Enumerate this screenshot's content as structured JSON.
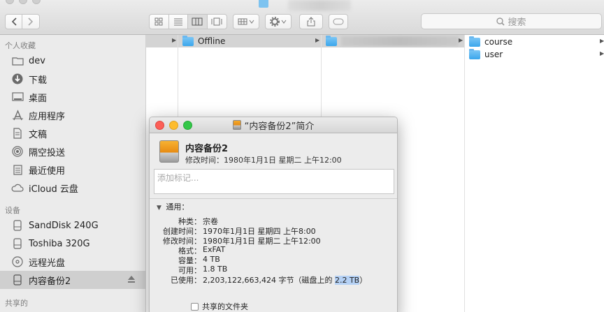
{
  "toolbar": {
    "search_placeholder": "搜索",
    "back_icon": "chevron-left-icon",
    "forward_icon": "chevron-right-icon"
  },
  "sidebar": {
    "favorites_heading": "个人收藏",
    "favorites": [
      {
        "label": "dev",
        "icon": "folder-icon"
      },
      {
        "label": "下载",
        "icon": "download-icon"
      },
      {
        "label": "桌面",
        "icon": "desktop-icon"
      },
      {
        "label": "应用程序",
        "icon": "applications-icon"
      },
      {
        "label": "文稿",
        "icon": "document-icon"
      },
      {
        "label": "隔空投送",
        "icon": "airdrop-icon"
      },
      {
        "label": "最近使用",
        "icon": "recents-icon"
      },
      {
        "label": "iCloud 云盘",
        "icon": "cloud-icon"
      }
    ],
    "devices_heading": "设备",
    "devices": [
      {
        "label": "SandDisk 240G",
        "icon": "drive-icon"
      },
      {
        "label": "Toshiba 320G",
        "icon": "drive-icon"
      },
      {
        "label": "远程光盘",
        "icon": "disc-icon"
      },
      {
        "label": "内容备份2",
        "icon": "drive-icon",
        "selected": true
      }
    ],
    "shared_heading": "共享的"
  },
  "columns": {
    "col1_item": "Offline",
    "col3_items": [
      "course",
      "user"
    ]
  },
  "info_window": {
    "title": "“内容备份2”简介",
    "name": "内容备份2",
    "modified": "修改时间：1980年1月1日 星期二 上午12:00",
    "tags_placeholder": "添加标记...",
    "general_label": "通用：",
    "fields": [
      {
        "key": "种类：",
        "value": "宗卷"
      },
      {
        "key": "创建时间：",
        "value": "1970年1月1日 星期四 上午8:00"
      },
      {
        "key": "修改时间：",
        "value": "1980年1月1日 星期二 上午12:00"
      },
      {
        "key": "格式：",
        "value": "ExFAT"
      },
      {
        "key": "容量：",
        "value": "4 TB"
      },
      {
        "key": "可用：",
        "value": "1.8 TB"
      }
    ],
    "used_key": "已使用：",
    "used_value_prefix": "2,203,122,663,424 字节（磁盘上的 ",
    "used_value_highlight": "2.2 TB",
    "used_value_suffix": "）",
    "shared_folder_label": "共享的文件夹"
  }
}
